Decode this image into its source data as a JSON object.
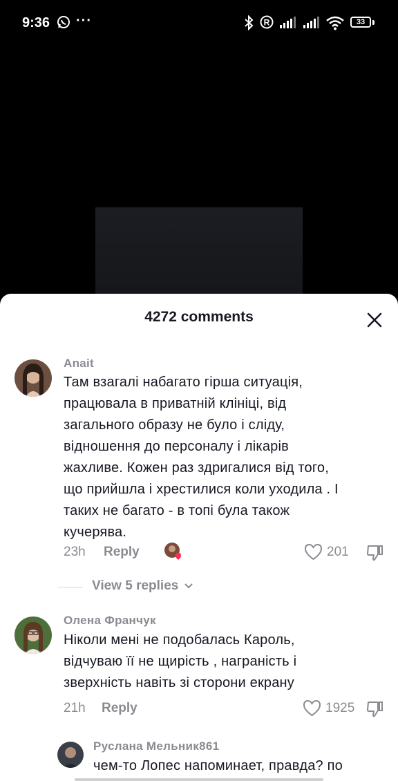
{
  "status_bar": {
    "time": "9:36",
    "more": "···",
    "battery": "33"
  },
  "sheet": {
    "title": "4272 comments"
  },
  "comments": [
    {
      "username": "Anait",
      "text_lines": [
        "Там взагалі набагато гірша ситуація,",
        "працювала в приватній клініці, від",
        "загального образу не було і сліду,",
        "відношення до персоналу і лікарів",
        "жахливе. Кожен раз здригалися від того,",
        "що прийшла і хрестилися коли уходила . І",
        "таких не багато - в топі була також",
        "кучерява."
      ],
      "time": "23h",
      "reply_label": "Reply",
      "likes": "201",
      "view_replies": "View 5 replies"
    },
    {
      "username": "Олена Франчук",
      "text_lines": [
        "Ніколи мені не подобалась Кароль,",
        "відчуваю її не щирість , награність і",
        "зверхність навіть зі сторони екрану"
      ],
      "time": "21h",
      "reply_label": "Reply",
      "likes": "1925"
    },
    {
      "username": "Руслана Мельник861",
      "text": "чем-то Лопес напоминает, правда? по"
    }
  ],
  "colors": {
    "text": "#161823",
    "muted": "#8a8b91",
    "background": "#ffffff"
  }
}
